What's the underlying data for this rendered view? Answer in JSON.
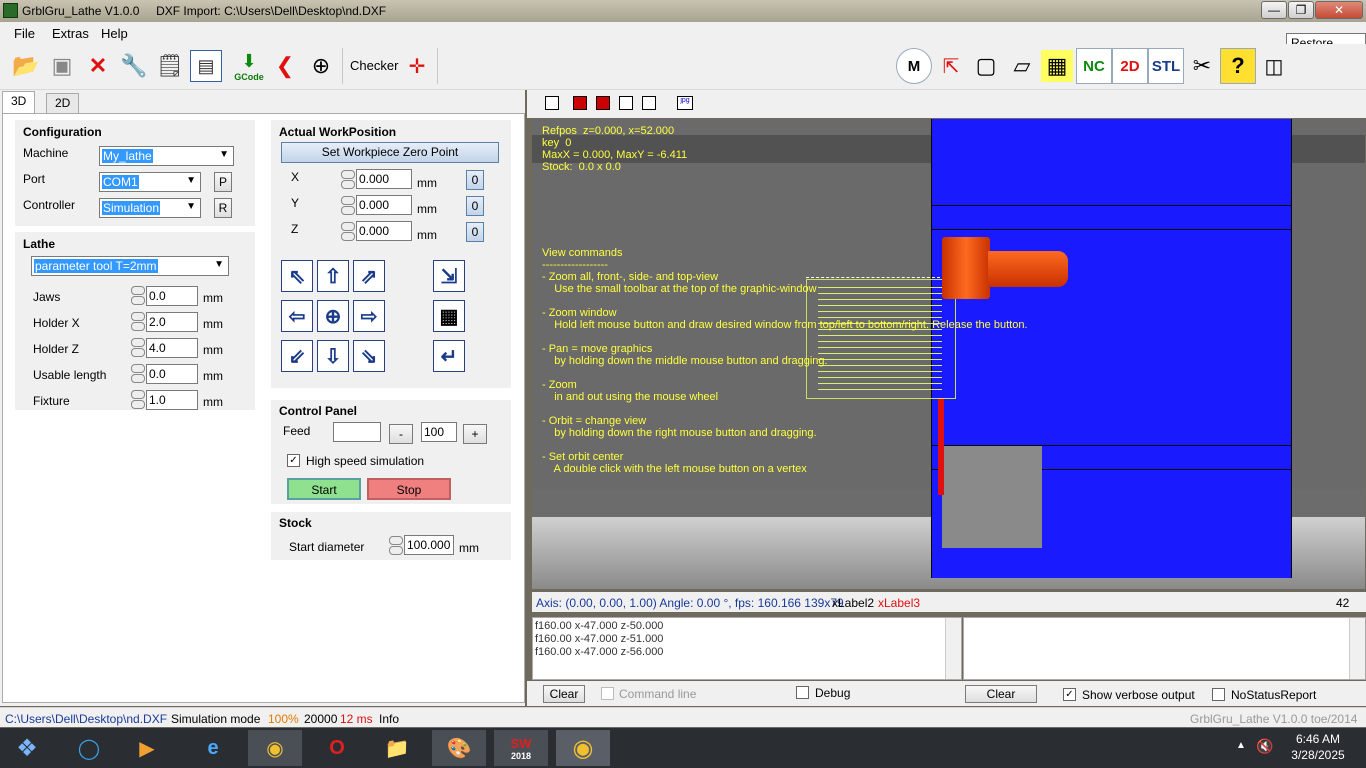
{
  "window": {
    "title": "GrblGru_Lathe V1.0.0     DXF Import: C:\\Users\\Dell\\Desktop\\nd.DXF",
    "tooltip": "Restore Down"
  },
  "menu": [
    "File",
    "Extras",
    "Help"
  ],
  "toolbar": {
    "gcode_label": "GCode",
    "checker_label": "Checker",
    "right_buttons": [
      "M",
      "NC",
      "2D",
      "STL"
    ]
  },
  "tabs": [
    "3D",
    "2D"
  ],
  "configuration": {
    "title": "Configuration",
    "machine_label": "Machine",
    "machine_value": "My_lathe",
    "port_label": "Port",
    "port_value": "COM1",
    "port_button": "P",
    "controller_label": "Controller",
    "controller_value": "Simulation",
    "controller_button": "R"
  },
  "lathe": {
    "title": "Lathe",
    "tool_value": "parameter tool T=2mm",
    "params": [
      {
        "label": "Jaws",
        "value": "0.0",
        "unit": "mm"
      },
      {
        "label": "Holder X",
        "value": "2.0",
        "unit": "mm"
      },
      {
        "label": "Holder Z",
        "value": "4.0",
        "unit": "mm"
      },
      {
        "label": "Usable length",
        "value": "0.0",
        "unit": "mm"
      },
      {
        "label": "Fixture",
        "value": "1.0",
        "unit": "mm"
      }
    ]
  },
  "workposition": {
    "title": "Actual WorkPosition",
    "zero_button": "Set Workpiece Zero Point",
    "axes": [
      {
        "label": "X",
        "value": "0.000",
        "unit": "mm",
        "button": "0"
      },
      {
        "label": "Y",
        "value": "0.000",
        "unit": "mm",
        "button": "0"
      },
      {
        "label": "Z",
        "value": "0.000",
        "unit": "mm",
        "button": "0"
      }
    ]
  },
  "control_panel": {
    "title": "Control Panel",
    "feed_label": "Feed",
    "feed_value": "",
    "minus": "-",
    "feed_percent": "100",
    "plus": "+",
    "high_speed_label": "High speed simulation",
    "start_label": "Start",
    "stop_label": "Stop",
    "colors": {
      "start": "#8fe08f",
      "stop": "#f08080"
    }
  },
  "stock": {
    "title": "Stock",
    "start_diameter_label": "Start diameter",
    "start_diameter_value": "100.000",
    "unit": "mm"
  },
  "graphics": {
    "info_lines": [
      "Refpos  z=0.000, x=52.000",
      "key  0",
      "MaxX = 0.000, MaxY = -6.411",
      "Stock:  0.0 x 0.0"
    ],
    "help_lines": [
      "View commands",
      "------------------",
      "- Zoom all, front-, side- and top-view",
      "    Use the small toolbar at the top of the graphic-window",
      "",
      "- Zoom window",
      "    Hold left mouse button and draw desired window from top/left to bottom/right. Release the button.",
      "",
      "- Pan = move graphics",
      "    by holding down the middle mouse button and dragging.",
      "",
      "- Zoom",
      "    in and out using the mouse wheel",
      "",
      "- Orbit = change view",
      "    by holding down the right mouse button and dragging.",
      "",
      "- Set orbit center",
      "    A double click with the left mouse button on a vertex"
    ],
    "colors": {
      "stock": "#1a1aff",
      "part": "#e84a10",
      "text": "#ffff40"
    }
  },
  "status_line": {
    "axis": "Axis: (0.00, 0.00, 1.00) Angle: 0.00 °, fps: 160.166   139x79",
    "xlabel2": "xLabel2",
    "xlabel3": "xLabel3",
    "count": "42"
  },
  "log": {
    "lines": [
      "f160.00 x-47.000 z-50.000",
      "f160.00 x-47.000 z-51.000",
      "f160.00 x-47.000 z-56.000"
    ]
  },
  "bottom_controls": {
    "clear_left": "Clear",
    "command_line": "Command line",
    "debug": "Debug",
    "clear_right": "Clear",
    "verbose": "Show verbose output",
    "no_status": "NoStatusReport"
  },
  "status_bar": {
    "path": "C:\\Users\\Dell\\Desktop\\nd.DXF",
    "mode": "Simulation mode",
    "percent": "100%",
    "value": "20000",
    "ms": "12 ms",
    "info": "Info",
    "version": "GrblGru_Lathe V1.0.0 toe/2014"
  },
  "taskbar": {
    "time": "6:46 AM",
    "date": "3/28/2025",
    "sw_label": "2018"
  }
}
